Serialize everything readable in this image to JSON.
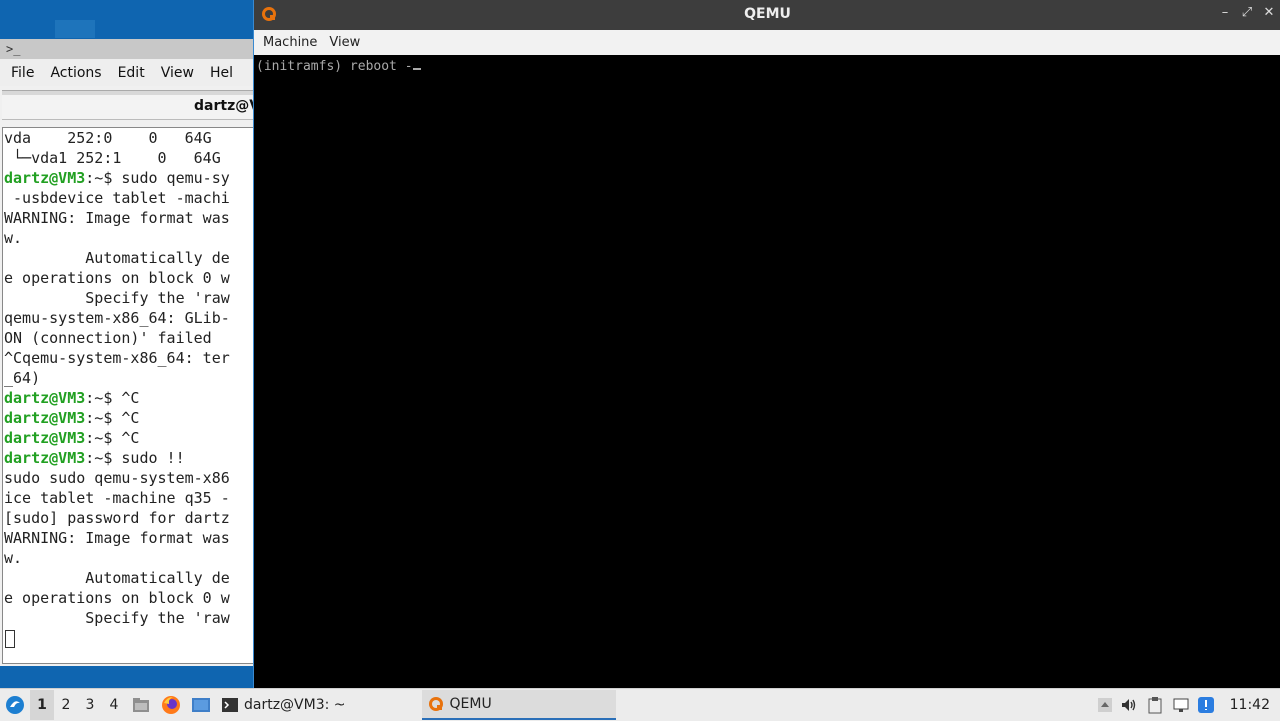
{
  "desktop": {
    "background": "#0f65b0"
  },
  "terminal": {
    "title_icon": ">_",
    "menu": [
      "File",
      "Actions",
      "Edit",
      "View",
      "Hel"
    ],
    "tab_title": "dartz@V",
    "lines": [
      {
        "prompt": "",
        "text": "vda    252:0    0   64G"
      },
      {
        "prompt": "",
        "text": " └─vda1 252:1    0   64G"
      },
      {
        "prompt": "dartz@VM3",
        "text": ":~$ sudo qemu-sy"
      },
      {
        "prompt": "",
        "text": " -usbdevice tablet -machi"
      },
      {
        "prompt": "",
        "text": "WARNING: Image format was"
      },
      {
        "prompt": "",
        "text": "w."
      },
      {
        "prompt": "",
        "text": "         Automatically de"
      },
      {
        "prompt": "",
        "text": "e operations on block 0 w"
      },
      {
        "prompt": "",
        "text": "         Specify the 'raw"
      },
      {
        "prompt": "",
        "text": "qemu-system-x86_64: GLib-"
      },
      {
        "prompt": "",
        "text": "ON (connection)' failed"
      },
      {
        "prompt": "",
        "text": "^Cqemu-system-x86_64: ter"
      },
      {
        "prompt": "",
        "text": "_64)"
      },
      {
        "prompt": "dartz@VM3",
        "text": ":~$ ^C"
      },
      {
        "prompt": "dartz@VM3",
        "text": ":~$ ^C"
      },
      {
        "prompt": "dartz@VM3",
        "text": ":~$ ^C"
      },
      {
        "prompt": "dartz@VM3",
        "text": ":~$ sudo !!"
      },
      {
        "prompt": "",
        "text": "sudo sudo qemu-system-x86"
      },
      {
        "prompt": "",
        "text": "ice tablet -machine q35 -"
      },
      {
        "prompt": "",
        "text": "[sudo] password for dartz"
      },
      {
        "prompt": "",
        "text": "WARNING: Image format was"
      },
      {
        "prompt": "",
        "text": "w."
      },
      {
        "prompt": "",
        "text": "         Automatically de"
      },
      {
        "prompt": "",
        "text": "e operations on block 0 w"
      },
      {
        "prompt": "",
        "text": "         Specify the 'raw"
      }
    ]
  },
  "qemu": {
    "title": "QEMU",
    "menu": [
      "Machine",
      "View"
    ],
    "console_text": "(initramfs) reboot -"
  },
  "taskbar": {
    "workspaces": [
      "1",
      "2",
      "3",
      "4"
    ],
    "active_workspace": "1",
    "tasks": [
      {
        "label": "dartz@VM3: ~",
        "icon": "terminal-icon"
      },
      {
        "label": "QEMU",
        "icon": "qemu-icon"
      }
    ],
    "clock": "11:42"
  }
}
